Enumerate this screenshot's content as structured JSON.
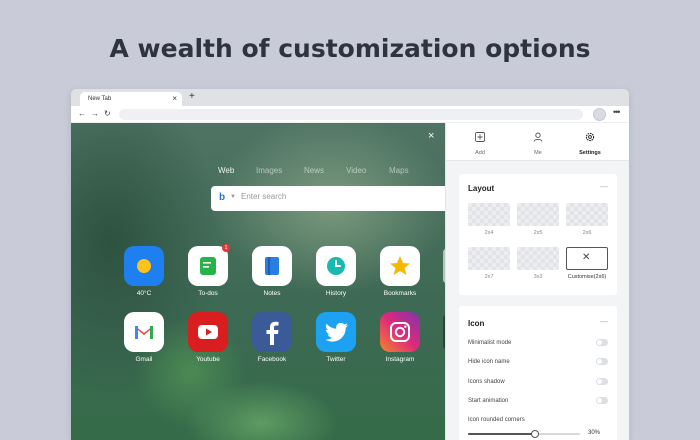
{
  "headline": "A wealth of customization options",
  "browser": {
    "tab_title": "New Tab",
    "tab_close": "×",
    "new_tab": "+",
    "nav": {
      "back": "←",
      "forward": "→",
      "reload": "↻",
      "more": "•••"
    }
  },
  "newtab": {
    "close": "×",
    "search_tabs": [
      "Web",
      "Images",
      "News",
      "Video",
      "Maps"
    ],
    "active_search_tab": "Web",
    "search_engine_icon": "b",
    "search_placeholder": "Enter search",
    "apps_row1": [
      {
        "label": "40°C",
        "icon": "weather-icon",
        "color": "#1e7ff0"
      },
      {
        "label": "To-dos",
        "icon": "todo-icon",
        "color": "#ffffff",
        "badge": "1"
      },
      {
        "label": "Notes",
        "icon": "notes-icon",
        "color": "#ffffff"
      },
      {
        "label": "History",
        "icon": "history-icon",
        "color": "#ffffff"
      },
      {
        "label": "Bookmarks",
        "icon": "bookmarks-icon",
        "color": "#ffffff"
      }
    ],
    "apps_row2": [
      {
        "label": "Gmail",
        "icon": "gmail-icon",
        "color": "#ffffff"
      },
      {
        "label": "Youtube",
        "icon": "youtube-icon",
        "color": "#d81e1e"
      },
      {
        "label": "Facebook",
        "icon": "facebook-icon",
        "color": "#3b5a98"
      },
      {
        "label": "Twitter",
        "icon": "twitter-icon",
        "color": "#1da1f2"
      },
      {
        "label": "Instagram",
        "icon": "instagram-icon",
        "color": "#c13584"
      }
    ]
  },
  "panel": {
    "top_buttons": [
      {
        "label": "Add",
        "icon": "add-icon"
      },
      {
        "label": "Me",
        "icon": "user-icon"
      },
      {
        "label": "Settings",
        "icon": "gear-icon"
      }
    ],
    "active_top": "Settings",
    "layout": {
      "title": "Layout",
      "collapse": "—",
      "options": [
        "2x4",
        "2x5",
        "2x6",
        "2x7",
        "3x3",
        "Customise(2x6)"
      ],
      "selected": "Customise(2x6)"
    },
    "icon_section": {
      "title": "Icon",
      "collapse": "—",
      "settings": [
        {
          "label": "Minimalist mode",
          "on": false
        },
        {
          "label": "Hide icon name",
          "on": false
        },
        {
          "label": "Icons shadow",
          "on": false
        },
        {
          "label": "Start animation",
          "on": false
        }
      ],
      "corners_label": "Icon rounded corners",
      "corners_value": 30,
      "corners_value_text": "30%"
    }
  }
}
